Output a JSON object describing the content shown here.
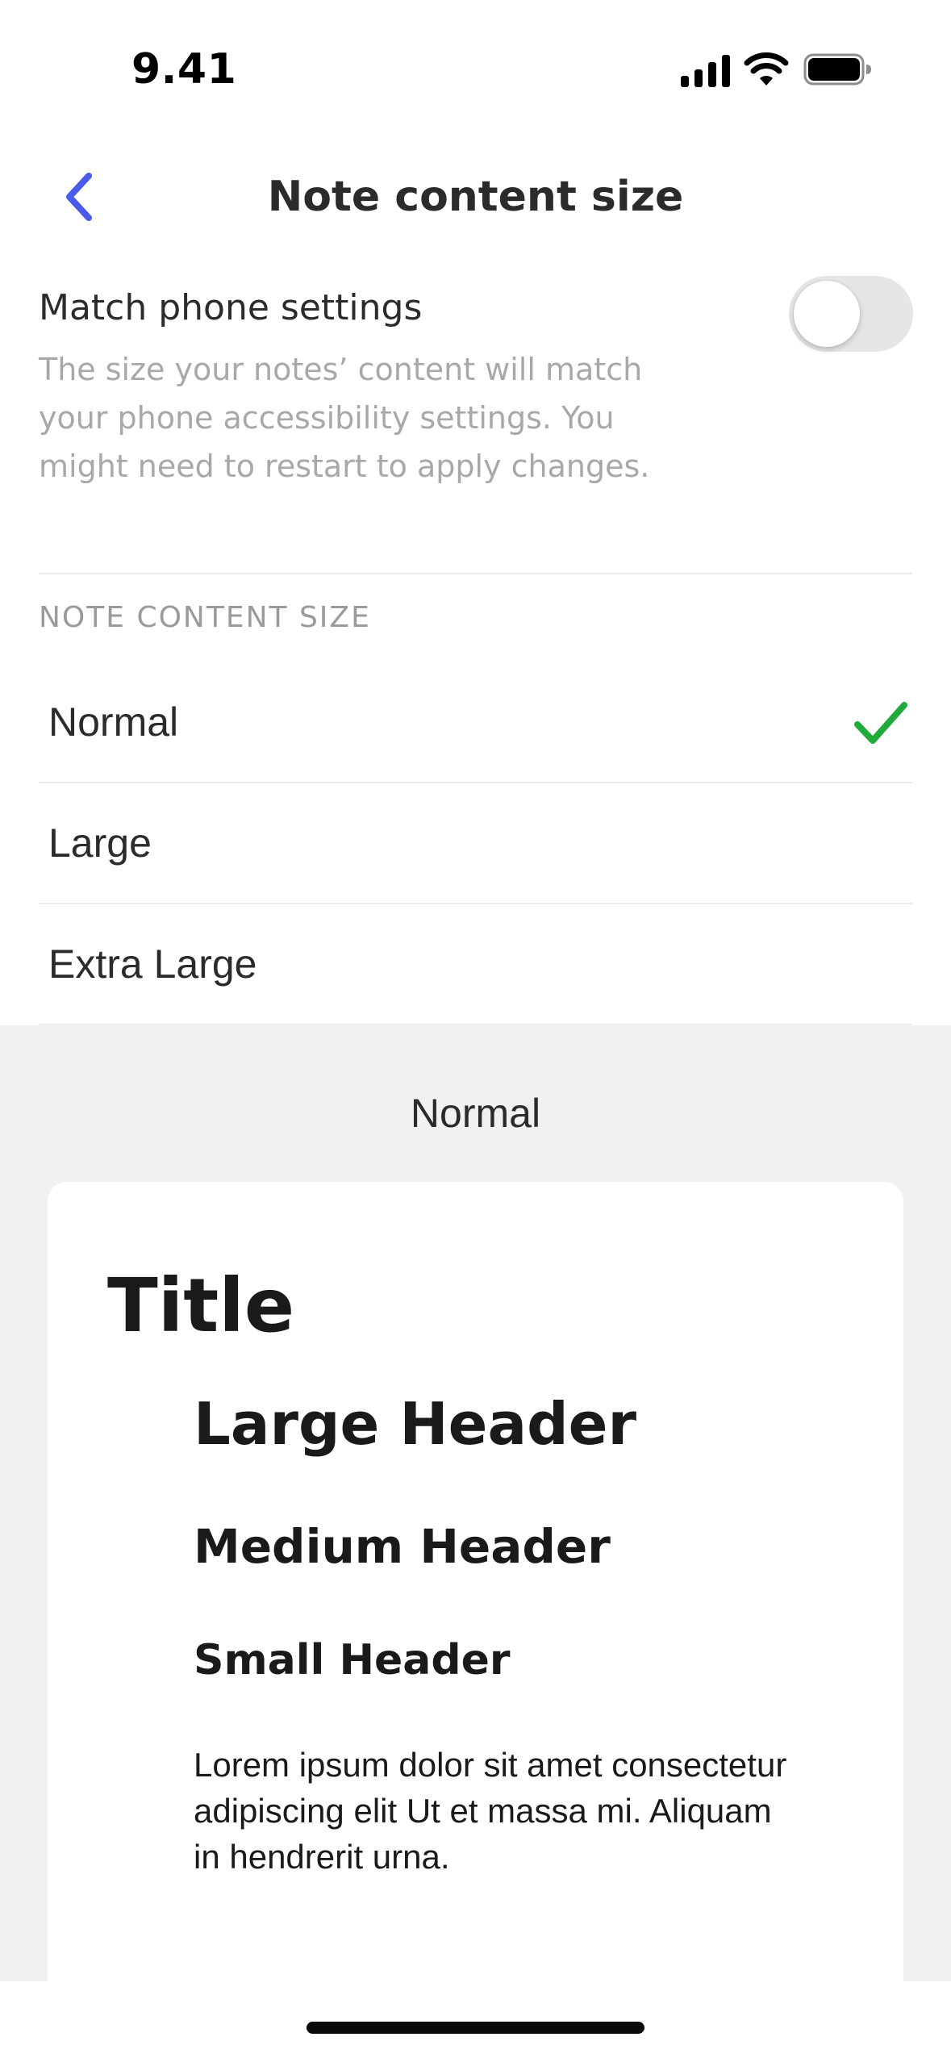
{
  "status_bar": {
    "time": "9.41",
    "icons": [
      "signal-icon",
      "wifi-icon",
      "battery-icon"
    ]
  },
  "nav": {
    "title": "Note content size",
    "back_icon": "chevron-left-icon"
  },
  "match_settings": {
    "title": "Match phone settings",
    "description": "The size your notes’ content will match your phone accessibility settings. You might need to restart to apply changes.",
    "toggle_on": false
  },
  "size_section": {
    "header": "NOTE CONTENT SIZE",
    "options": [
      {
        "label": "Normal",
        "selected": true
      },
      {
        "label": "Large",
        "selected": false
      },
      {
        "label": "Extra Large",
        "selected": false
      }
    ]
  },
  "preview": {
    "label": "Normal",
    "title": "Title",
    "large_header": "Large Header",
    "medium_header": "Medium Header",
    "small_header": "Small Header",
    "body": "Lorem ipsum dolor sit amet consectetur adipiscing elit Ut et massa mi. Aliquam in hendrerit urna."
  },
  "colors": {
    "accent": "#4a5be8",
    "check": "#1faa3a",
    "toggle_off": "#e6e6e6",
    "secondary_text": "#a8a8a8",
    "preview_bg": "#f1f1f1"
  }
}
